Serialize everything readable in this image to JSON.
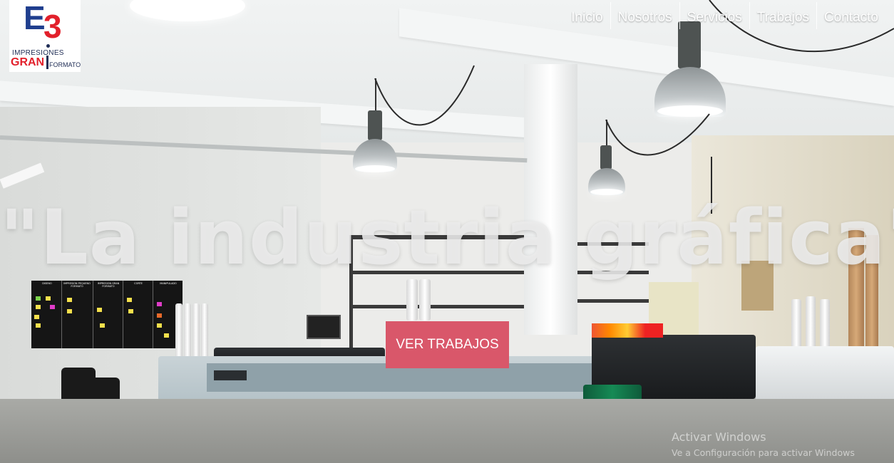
{
  "brand": {
    "logo_mark_e": "E",
    "logo_mark_3": "3",
    "line1": "IMPRESIONES",
    "gran": "GRAN",
    "formato": "FORMATO",
    "color_blue": "#1f3e8e",
    "color_red": "#e2202b"
  },
  "nav": {
    "items": [
      {
        "label": "Inicio"
      },
      {
        "label": "Nosotros"
      },
      {
        "label": "Servicios"
      },
      {
        "label": "Trabajos"
      },
      {
        "label": "Contacto"
      }
    ]
  },
  "hero": {
    "headline": "\"La industria gráfica\"",
    "cta_label": "VER TRABAJOS",
    "cta_color": "#d9576a"
  },
  "watermark": {
    "title": "Activar Windows",
    "subtitle": "Ve a Configuración para activar Windows"
  },
  "board": {
    "columns": [
      "DISEÑO",
      "IMPRESIÓN PEQUEÑO FORMATO",
      "IMPRESIÓN GRAN FORMATO",
      "CORTE",
      "MANIPULADO"
    ]
  }
}
